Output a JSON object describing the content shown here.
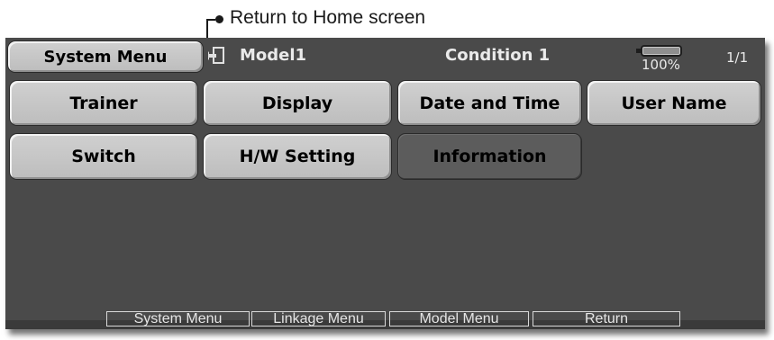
{
  "annotation": {
    "text": "Return to Home screen"
  },
  "header": {
    "menu_button_label": "System Menu",
    "model_name": "Model1",
    "condition": "Condition 1",
    "battery_percent": "100%",
    "page_indicator": "1/1"
  },
  "menu_buttons": [
    {
      "label": "Trainer",
      "state": "enabled"
    },
    {
      "label": "Display",
      "state": "enabled"
    },
    {
      "label": "Date and Time",
      "state": "enabled"
    },
    {
      "label": "User Name",
      "state": "enabled"
    },
    {
      "label": "Switch",
      "state": "enabled"
    },
    {
      "label": "H/W Setting",
      "state": "enabled"
    },
    {
      "label": "Information",
      "state": "selected"
    }
  ],
  "bottom_tabs": [
    "System Menu",
    "Linkage Menu",
    "Model Menu",
    "Return"
  ],
  "icons": {
    "home": "home-return-icon",
    "battery": "battery-icon"
  },
  "colors": {
    "screen_bg": "#4a4a4a",
    "button_bg": "#c6c6c6",
    "selected_button_bg": "#5c5c5c",
    "header_text": "#eaeaea"
  }
}
